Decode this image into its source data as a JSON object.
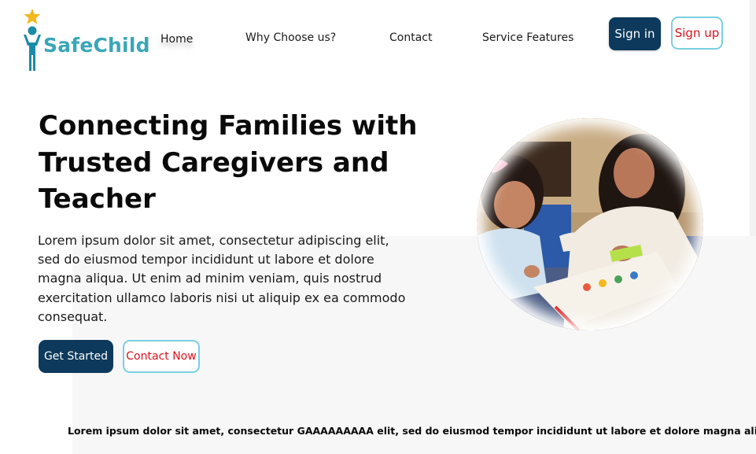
{
  "brand": {
    "name": "SafeChild",
    "icon": "star-person-logo",
    "color": "#3aa6b8"
  },
  "nav": {
    "items": [
      {
        "label": "Home"
      },
      {
        "label": "Why Choose us?"
      },
      {
        "label": "Contact"
      },
      {
        "label": "Service Features"
      }
    ],
    "sign_in": "Sign in",
    "sign_up": "Sign up"
  },
  "hero": {
    "title": "Connecting Families with Trusted Caregivers and Teacher",
    "body": "Lorem ipsum dolor sit amet, consectetur adipiscing elit, sed do eiusmod tempor incididunt ut labore et dolore magna aliqua. Ut enim ad minim veniam, quis nostrud exercitation ullamco laboris nisi ut aliquip ex ea commodo consequat.",
    "primary_cta": "Get Started",
    "secondary_cta": "Contact Now",
    "image": "woman-and-girl-learning-photo"
  },
  "footer": {
    "text": "Lorem ipsum dolor sit amet, consectetur GAAAAAAAAA elit, sed do eiusmod tempor incididunt ut labore et dolore magna aliqu"
  },
  "colors": {
    "primary_dark": "#0d3a5c",
    "accent_red": "#d9111d",
    "accent_border": "#79cfe0",
    "star": "#f2b81c"
  }
}
